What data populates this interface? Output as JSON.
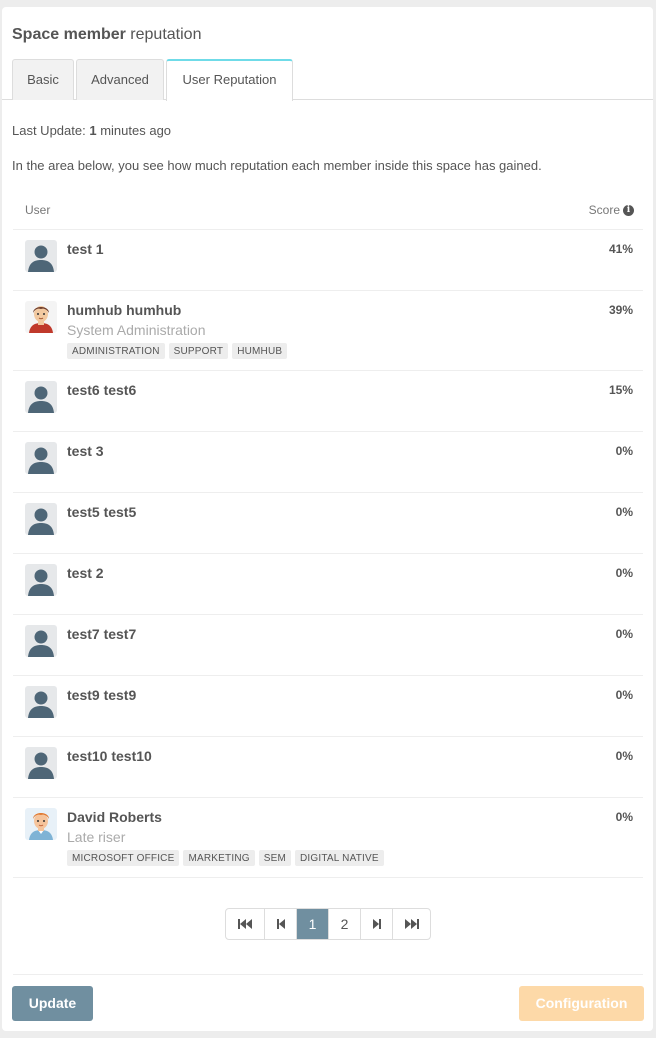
{
  "panel": {
    "title_bold": "Space member",
    "title_light": "reputation"
  },
  "tabs": [
    {
      "label": "Basic",
      "active": false
    },
    {
      "label": "Advanced",
      "active": false
    },
    {
      "label": "User Reputation",
      "active": true
    }
  ],
  "last_update": {
    "prefix": "Last Update:",
    "value": "1",
    "suffix": "minutes ago"
  },
  "description": "In the area below, you see how much reputation each member inside this space has gained.",
  "table": {
    "col_user": "User",
    "col_score": "Score",
    "info_icon": "info-circle-icon",
    "rows": [
      {
        "name": "test 1",
        "title": "",
        "tags": [],
        "score": "41%",
        "avatar": "default"
      },
      {
        "name": "humhub humhub",
        "title": "System Administration",
        "tags": [
          "ADMINISTRATION",
          "SUPPORT",
          "HUMHUB"
        ],
        "score": "39%",
        "avatar": "dark-hair"
      },
      {
        "name": "test6 test6",
        "title": "",
        "tags": [],
        "score": "15%",
        "avatar": "default"
      },
      {
        "name": "test 3",
        "title": "",
        "tags": [],
        "score": "0%",
        "avatar": "default"
      },
      {
        "name": "test5 test5",
        "title": "",
        "tags": [],
        "score": "0%",
        "avatar": "default"
      },
      {
        "name": "test 2",
        "title": "",
        "tags": [],
        "score": "0%",
        "avatar": "default"
      },
      {
        "name": "test7 test7",
        "title": "",
        "tags": [],
        "score": "0%",
        "avatar": "default"
      },
      {
        "name": "test9 test9",
        "title": "",
        "tags": [],
        "score": "0%",
        "avatar": "default"
      },
      {
        "name": "test10 test10",
        "title": "",
        "tags": [],
        "score": "0%",
        "avatar": "default"
      },
      {
        "name": "David Roberts",
        "title": "Late riser",
        "tags": [
          "MICROSOFT OFFICE",
          "MARKETING",
          "SEM",
          "DIGITAL NATIVE"
        ],
        "score": "0%",
        "avatar": "ginger-hair"
      }
    ]
  },
  "pagination": {
    "first_icon": "first-page-icon",
    "prev_icon": "previous-page-icon",
    "pages": [
      "1",
      "2"
    ],
    "current": "1",
    "next_icon": "next-page-icon",
    "last_icon": "last-page-icon"
  },
  "buttons": {
    "update_label": "Update",
    "configuration_label": "Configuration"
  },
  "colors": {
    "accent_tab": "#6fdbe8",
    "primary": "#708fa0",
    "warning_disabled": "#fdd9a8"
  }
}
